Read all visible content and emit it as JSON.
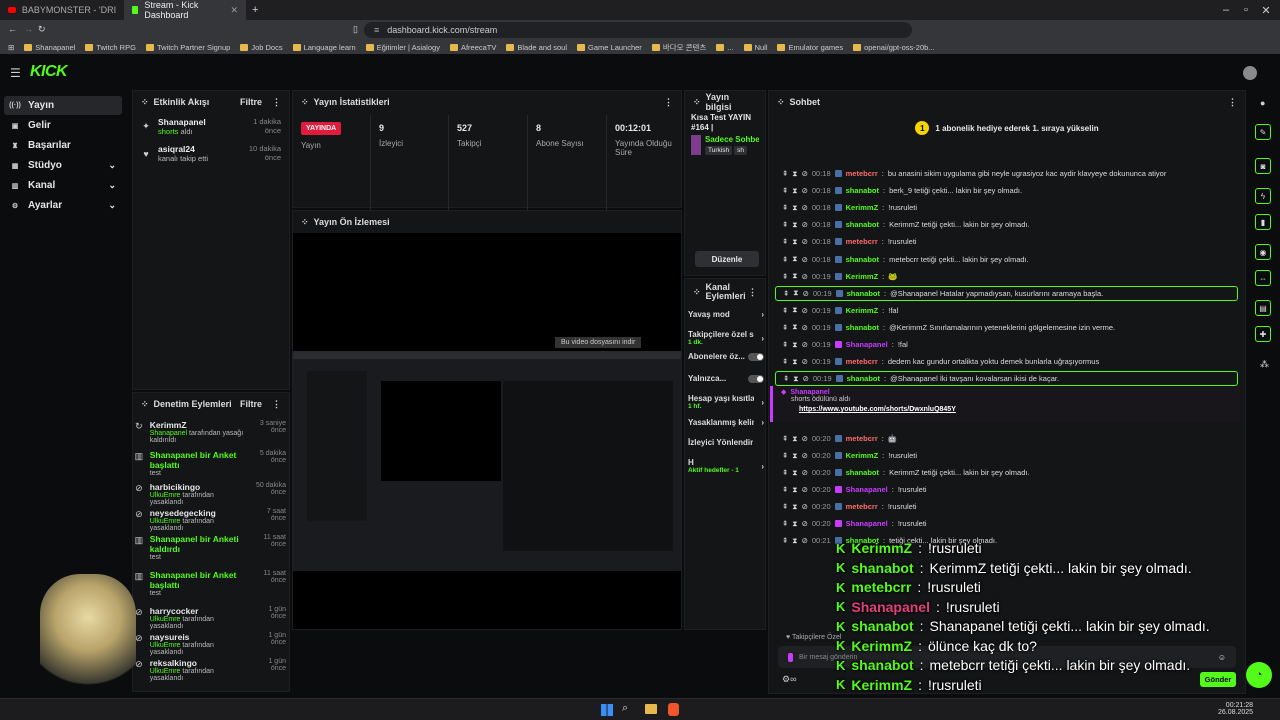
{
  "browser": {
    "tabs": [
      {
        "label": "BABYMONSTER - 'DRIP' M/V - YouTube"
      },
      {
        "label": "Stream - Kick Dashboard"
      }
    ],
    "url": "dashboard.kick.com/stream",
    "bookmarks": [
      "Shanapanel",
      "Twitch RPG",
      "Twitch Partner Signup",
      "Job Docs",
      "Language learn",
      "Eğitimler | Asialogy",
      "AfreecaTV",
      "Blade and soul",
      "Game Launcher",
      "바다모 콘텐츠",
      "...",
      "Null",
      "Emulator games",
      "openai/gpt-oss-20b..."
    ]
  },
  "brand": {
    "logo": "KICK",
    "accent": "#53fc18"
  },
  "sidebar": {
    "items": [
      {
        "label": "Yayın",
        "icon": "broadcast-icon"
      },
      {
        "label": "Gelir",
        "icon": "wallet-icon"
      },
      {
        "label": "Başarılar",
        "icon": "trophy-icon"
      },
      {
        "label": "Stüdyo",
        "icon": "studio-icon"
      },
      {
        "label": "Kanal",
        "icon": "channel-icon"
      },
      {
        "label": "Ayarlar",
        "icon": "gear-icon"
      }
    ]
  },
  "activity": {
    "title": "Etkinlik Akışı",
    "filter": "Filtre",
    "items": [
      {
        "name": "Shanapanel",
        "detail": "shorts",
        "detail2": "aldı",
        "time": "1 dakika önce"
      },
      {
        "name": "asiqral24",
        "detail": "kanalı takip etti",
        "time": "10 dakika önce"
      }
    ]
  },
  "stats": {
    "title": "Yayın İstatistikleri",
    "live_badge": "YAYINDA",
    "live_label": "Yayın",
    "cells": [
      {
        "value": "9",
        "label": "İzleyici"
      },
      {
        "value": "527",
        "label": "Takipçi"
      },
      {
        "value": "8",
        "label": "Abone Sayısı"
      },
      {
        "value": "00:12:01",
        "label": "Yayında Olduğu Süre"
      }
    ]
  },
  "info": {
    "title": "Yayın bilgisi",
    "stream_title": "Kısa Test YAYIN #164 |",
    "category": "Sadece Sohbet",
    "tags": [
      "Turkish",
      "sh"
    ],
    "edit": "Düzenle"
  },
  "preview": {
    "title": "Yayın Ön İzlemesi",
    "download": "Bu video dosyasını indir"
  },
  "channel_actions": {
    "title": "Kanal Eylemleri",
    "items": [
      {
        "label": "Yavaş mod",
        "type": "chevron"
      },
      {
        "label": "Takipçilere özel sc",
        "sub": "1 dk.",
        "type": "chevron"
      },
      {
        "label": "Abonelere öz...",
        "type": "toggle"
      },
      {
        "label": "Yalnızca...",
        "type": "toggle"
      },
      {
        "label": "Hesap yaşı kısıtlar",
        "sub": "1 hf.",
        "type": "chevron"
      },
      {
        "label": "Yasaklanmış kelim",
        "type": "chevron"
      },
      {
        "label": "İzleyici Yönlendir",
        "type": "none"
      },
      {
        "label": "H",
        "sub": "Aktif hedefler - 1",
        "type": "chevron"
      }
    ]
  },
  "moderation": {
    "title": "Denetim Eylemleri",
    "filter": "Filtre",
    "items": [
      {
        "name": "KerimmZ",
        "by": "Shanapanel",
        "action": "tarafından yasağı kaldırıldı",
        "time": "3 saniye önce"
      },
      {
        "name": "Shanapanel bir Anket başlattı",
        "by": "",
        "action": "test",
        "time": "5 dakika önce"
      },
      {
        "name": "harbicikingo",
        "by": "UlkuEmre",
        "action": "tarafından yasaklandı",
        "time": "50 dakika önce"
      },
      {
        "name": "neysedegecking",
        "by": "UlkuEmre",
        "action": "tarafından yasaklandı",
        "time": "7 saat önce"
      },
      {
        "name": "Shanapanel bir Anketi kaldırdı",
        "by": "",
        "action": "test",
        "time": "11 saat önce"
      },
      {
        "name": "Shanapanel bir Anket başlattı",
        "by": "",
        "action": "test",
        "time": "11 saat önce"
      },
      {
        "name": "harrycocker",
        "by": "UlkuEmre",
        "action": "tarafından yasaklandı",
        "time": "1 gün önce"
      },
      {
        "name": "naysureis",
        "by": "UlkuEmre",
        "action": "tarafından yasaklandı",
        "time": "1 gün önce"
      },
      {
        "name": "reksalkingo",
        "by": "UlkuEmre",
        "action": "tarafından yasaklandı",
        "time": "1 gün önce"
      }
    ]
  },
  "chat": {
    "title": "Sohbet",
    "banner": "1 abonelik hediye ederek 1. sıraya yükselin",
    "lines": [
      {
        "time": "00:18",
        "user": "metebcrr",
        "color": "#ff6b6b",
        "msg": "bu anasini sikim uygulama gibi neyle ugrasiyoz kac aydir klavyeye dokununca atiyor"
      },
      {
        "time": "00:18",
        "user": "shanabot",
        "color": "#53fc18",
        "msg": "berk_9 tetiği çekti... lakin bir şey olmadı."
      },
      {
        "time": "00:18",
        "user": "KerimmZ",
        "color": "#53fc18",
        "msg": "!rusruleti"
      },
      {
        "time": "00:18",
        "user": "shanabot",
        "color": "#53fc18",
        "msg": "KerimmZ tetiği çekti... lakin bir şey olmadı."
      },
      {
        "time": "00:18",
        "user": "metebcrr",
        "color": "#ff6b6b",
        "msg": "!rusruleti"
      },
      {
        "time": "00:18",
        "user": "shanabot",
        "color": "#53fc18",
        "msg": "metebcrr tetiği çekti... lakin bir şey olmadı."
      },
      {
        "time": "00:19",
        "user": "KerimmZ",
        "color": "#53fc18",
        "msg": "🐸"
      },
      {
        "time": "00:19",
        "user": "shanabot",
        "color": "#53fc18",
        "msg": "@Shanapanel Hatalar yapmadıysan, kusurlarını aramaya başla.",
        "hl": true
      },
      {
        "time": "00:19",
        "user": "KerimmZ",
        "color": "#53fc18",
        "msg": "!fal"
      },
      {
        "time": "00:19",
        "user": "shanabot",
        "color": "#53fc18",
        "msg": "@KerimmZ Sınırlamalarının yeteneklerini gölgelemesine izin verme."
      },
      {
        "time": "00:19",
        "user": "Shanapanel",
        "color": "#c83cff",
        "msg": "!fal"
      },
      {
        "time": "00:19",
        "user": "metebcrr",
        "color": "#ff6b6b",
        "msg": "dedem kac gundur ortalikta yoktu demek bunlarla uğraşıyormus"
      },
      {
        "time": "00:19",
        "user": "shanabot",
        "color": "#53fc18",
        "msg": "@Shanapanel İki tavşanı kovalarsan ikisi de kaçar.",
        "hl": true
      }
    ],
    "redeem": {
      "user": "Shanapanel",
      "text": "shorts ödülünü aldı",
      "link": "https://www.youtube.com/shorts/DwxnluQ845Y"
    },
    "lines2": [
      {
        "time": "00:20",
        "user": "metebcrr",
        "color": "#ff6b6b",
        "msg": "🤖"
      },
      {
        "time": "00:20",
        "user": "KerimmZ",
        "color": "#53fc18",
        "msg": "!rusruleti"
      },
      {
        "time": "00:20",
        "user": "shanabot",
        "color": "#53fc18",
        "msg": "KerimmZ tetiği çekti... lakin bir şey olmadı."
      },
      {
        "time": "00:20",
        "user": "Shanapanel",
        "color": "#c83cff",
        "msg": "!rusruleti"
      },
      {
        "time": "00:20",
        "user": "metebcrr",
        "color": "#ff6b6b",
        "msg": "!rusruleti"
      },
      {
        "time": "00:20",
        "user": "Shanapanel",
        "color": "#c83cff",
        "msg": "!rusruleti"
      },
      {
        "time": "00:21",
        "user": "shanabot",
        "color": "#53fc18",
        "msg": "tetiği çekti... lakin bir şey olmadı."
      }
    ],
    "pinned": "Takipçilere Özel",
    "input_placeholder": "Bir mesaj gönderin",
    "send": "Gönder"
  },
  "overlay": [
    {
      "user": "KerimmZ",
      "color": "#53fc18",
      "msg": "!rusruleti"
    },
    {
      "user": "shanabot",
      "color": "#53fc18",
      "msg": "KerimmZ tetiği çekti... lakin bir şey olmadı."
    },
    {
      "user": "metebcrr",
      "color": "#53fc18",
      "msg": "!rusruleti"
    },
    {
      "user": "Shanapanel",
      "color": "#e4407a",
      "msg": "!rusruleti"
    },
    {
      "user": "shanabot",
      "color": "#53fc18",
      "msg": "Shanapanel tetiği çekti... lakin bir şey olmadı."
    },
    {
      "user": "KerimmZ",
      "color": "#53fc18",
      "msg": "ölünce kaç dk to?"
    },
    {
      "user": "shanabot",
      "color": "#53fc18",
      "msg": "metebcrr tetiği çekti... lakin bir şey olmadı."
    },
    {
      "user": "KerimmZ",
      "color": "#53fc18",
      "msg": "!rusruleti"
    }
  ],
  "taskbar": {
    "time": "00:21:28",
    "date": "26.08.2025"
  }
}
